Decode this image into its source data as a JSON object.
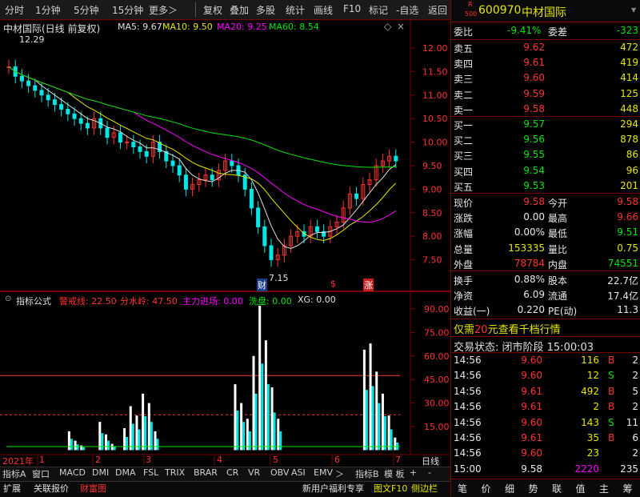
{
  "toolbar": {
    "left": [
      "分时",
      "1分钟",
      "5分钟",
      "15分钟",
      "更多＞"
    ],
    "right": [
      "复权",
      "叠加",
      "多股",
      "统计",
      "画线",
      "F10",
      "标记",
      "-自选",
      "返回"
    ]
  },
  "main_title": "中材国际(日线 前复权)",
  "ma": {
    "ma5": "MA5: 9.67",
    "ma10": "MA10: 9.50",
    "ma20": "MA20: 9.25",
    "ma60": "MA60: 8.54"
  },
  "price_axis": [
    "12.00",
    "11.50",
    "11.00",
    "10.50",
    "10.00",
    "9.50",
    "9.00",
    "8.50",
    "8.00",
    "7.50"
  ],
  "hi_label": "12.29",
  "lo_label": "7.15",
  "markers": {
    "cai": "财",
    "s": "$",
    "zhang": "涨"
  },
  "indicator": {
    "name": "指标公式",
    "l1": "警戒线: 22.50",
    "l2": "分水岭: 47.50",
    "l3": "主力进场: 0.00",
    "l4": "洗盘: 0.00",
    "l5": "XG: 0.00"
  },
  "ind_axis": [
    "90.00",
    "75.00",
    "60.00",
    "45.00",
    "30.00",
    "15.00"
  ],
  "date_axis": {
    "year": "2021年",
    "m1": "1",
    "m2": "2",
    "m3": "3",
    "m4": "4",
    "m5": "5",
    "m6": "6",
    "m7": "7",
    "period": "日线"
  },
  "tabs": [
    "指标A",
    "窗口",
    "MACD",
    "DMI",
    "DMA",
    "FSL",
    "TRIX",
    "BRAR",
    "CR",
    "VR",
    "OBV",
    "ASI",
    "EMV",
    "＞",
    "指标B",
    "模 板",
    "+",
    "-"
  ],
  "tabs2": {
    "ext": "扩展",
    "guanlian": "关联报价",
    "caifu": "财富图",
    "promo": "新用户福利专享",
    "f10": "图文F10",
    "side": "侧边栏"
  },
  "stock": {
    "code": "600970",
    "name": "中材国际",
    "rlabel": "R",
    "num": "500"
  },
  "weibi": {
    "label": "委比",
    "val": "-9.41%",
    "label2": "委差",
    "val2": "-323"
  },
  "sells": [
    {
      "label": "卖五",
      "price": "9.62",
      "vol": "472"
    },
    {
      "label": "卖四",
      "price": "9.61",
      "vol": "419"
    },
    {
      "label": "卖三",
      "price": "9.60",
      "vol": "414"
    },
    {
      "label": "卖二",
      "price": "9.59",
      "vol": "125"
    },
    {
      "label": "卖一",
      "price": "9.58",
      "vol": "448"
    }
  ],
  "buys": [
    {
      "label": "买一",
      "price": "9.57",
      "vol": "294"
    },
    {
      "label": "买二",
      "price": "9.56",
      "vol": "878"
    },
    {
      "label": "买三",
      "price": "9.55",
      "vol": "86"
    },
    {
      "label": "买四",
      "price": "9.54",
      "vol": "96"
    },
    {
      "label": "买五",
      "price": "9.53",
      "vol": "201"
    }
  ],
  "quote": [
    {
      "l1": "现价",
      "v1": "9.58",
      "l2": "今开",
      "v2": "9.58"
    },
    {
      "l1": "涨跌",
      "v1": "0.00",
      "l2": "最高",
      "v2": "9.66"
    },
    {
      "l1": "涨幅",
      "v1": "0.00%",
      "l2": "最低",
      "v2": "9.51"
    },
    {
      "l1": "总量",
      "v1": "153335",
      "l2": "量比",
      "v2": "0.75"
    },
    {
      "l1": "外盘",
      "v1": "78784",
      "l2": "内盘",
      "v2": "74551"
    }
  ],
  "stats": [
    {
      "l1": "换手",
      "v1": "0.88%",
      "l2": "股本",
      "v2": "22.7亿"
    },
    {
      "l1": "净资",
      "v1": "6.09",
      "l2": "流通",
      "v2": "17.4亿"
    },
    {
      "l1": "收益(一)",
      "v1": "0.220",
      "l2": "PE(动)",
      "v2": "11.3"
    }
  ],
  "promo_line": {
    "pre": "仅需",
    "num": "20",
    "post": "元查看千档行情"
  },
  "trade_status": "交易状态: 闭市阶段 15:00:03",
  "ticks": [
    {
      "t": "14:56",
      "p": "9.60",
      "v": "116",
      "d": "B",
      "n": "2"
    },
    {
      "t": "14:56",
      "p": "9.60",
      "v": "12",
      "d": "S",
      "n": "2"
    },
    {
      "t": "14:56",
      "p": "9.61",
      "v": "492",
      "d": "B",
      "n": "5"
    },
    {
      "t": "14:56",
      "p": "9.61",
      "v": "2",
      "d": "B",
      "n": "2"
    },
    {
      "t": "14:56",
      "p": "9.60",
      "v": "143",
      "d": "S",
      "n": "11"
    },
    {
      "t": "14:56",
      "p": "9.61",
      "v": "35",
      "d": "B",
      "n": "6"
    },
    {
      "t": "14:56",
      "p": "9.60",
      "v": "23",
      "d": "",
      "n": "2"
    },
    {
      "t": "15:00",
      "p": "9.58",
      "v": "2220",
      "d": "",
      "n": "235"
    }
  ],
  "bottom_nav": [
    "笔",
    "价",
    "细",
    "势",
    "联",
    "值",
    "主",
    "筹"
  ]
}
